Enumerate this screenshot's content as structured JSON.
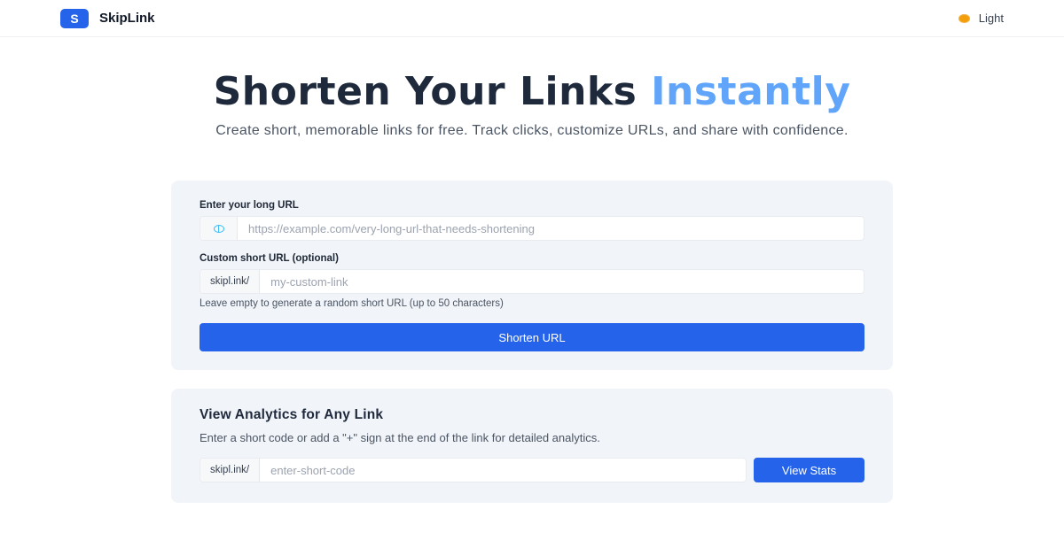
{
  "header": {
    "logo_letter": "S",
    "brand_name": "SkipLink",
    "theme_label": "Light"
  },
  "hero": {
    "title_main": "Shorten Your Links ",
    "title_accent": "Instantly",
    "subtitle": "Create short, memorable links for free. Track clicks, customize URLs, and share with confidence."
  },
  "shorten_form": {
    "long_url_label": "Enter your long URL",
    "long_url_placeholder": "https://example.com/very-long-url-that-needs-shortening",
    "long_url_value": "",
    "custom_label": "Custom short URL (optional)",
    "custom_prefix": "skipl.ink/",
    "custom_placeholder": "my-custom-link",
    "custom_value": "",
    "custom_hint": "Leave empty to generate a random short URL (up to 50 characters)",
    "submit_label": "Shorten URL"
  },
  "analytics": {
    "title": "View Analytics for Any Link",
    "description": "Enter a short code or add a \"+\" sign at the end of the link for detailed analytics.",
    "prefix": "skipl.ink/",
    "placeholder": "enter-short-code",
    "value": "",
    "button_label": "View Stats"
  },
  "colors": {
    "primary": "#2563eb",
    "accent": "#60a5fa",
    "card_bg": "#f1f4f9"
  },
  "icons": {
    "theme": "sun-icon",
    "url_input": "globe-icon"
  }
}
